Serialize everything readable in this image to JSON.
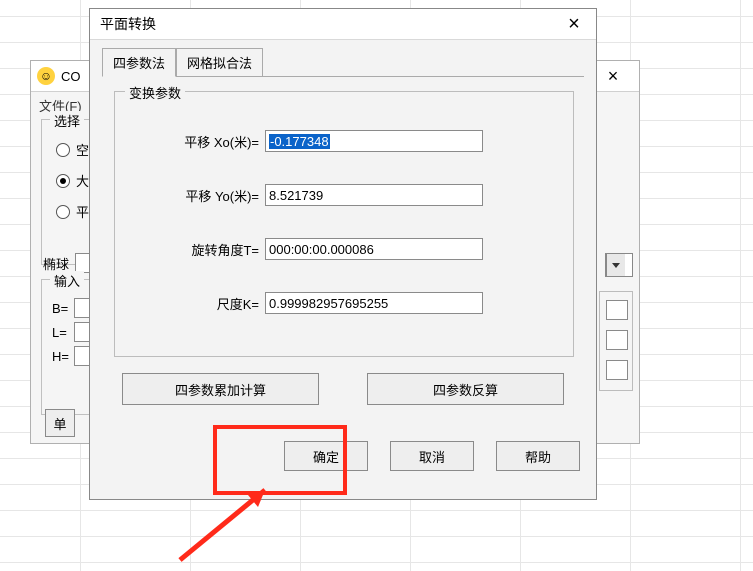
{
  "back_window": {
    "title_fragment": "CO",
    "menu_file": "文件(F)",
    "close_glyph": "×",
    "group_select_label": "选择",
    "radio_kong": "空",
    "radio_da": "大",
    "radio_ping": "平",
    "ellipsoid_label": "椭球",
    "group_input_label": "输入",
    "b_label": "B=",
    "l_label": "L=",
    "h_label": "H=",
    "single_btn_fragment": "单"
  },
  "dialog": {
    "title": "平面转换",
    "close_glyph": "×",
    "tabs": {
      "four_param": "四参数法",
      "grid_fit": "网格拟合法"
    },
    "params_legend": "变换参数",
    "fields": {
      "xo_label": "平移 Xo(米)=",
      "xo_value": "-0.177348",
      "yo_label": "平移 Yo(米)=",
      "yo_value": "8.521739",
      "t_label": "旋转角度T=",
      "t_value": "000:00:00.000086",
      "k_label": "尺度K=",
      "k_value": "0.999982957695255"
    },
    "buttons": {
      "accumulate": "四参数累加计算",
      "inverse": "四参数反算",
      "ok": "确定",
      "cancel": "取消",
      "help": "帮助"
    }
  }
}
